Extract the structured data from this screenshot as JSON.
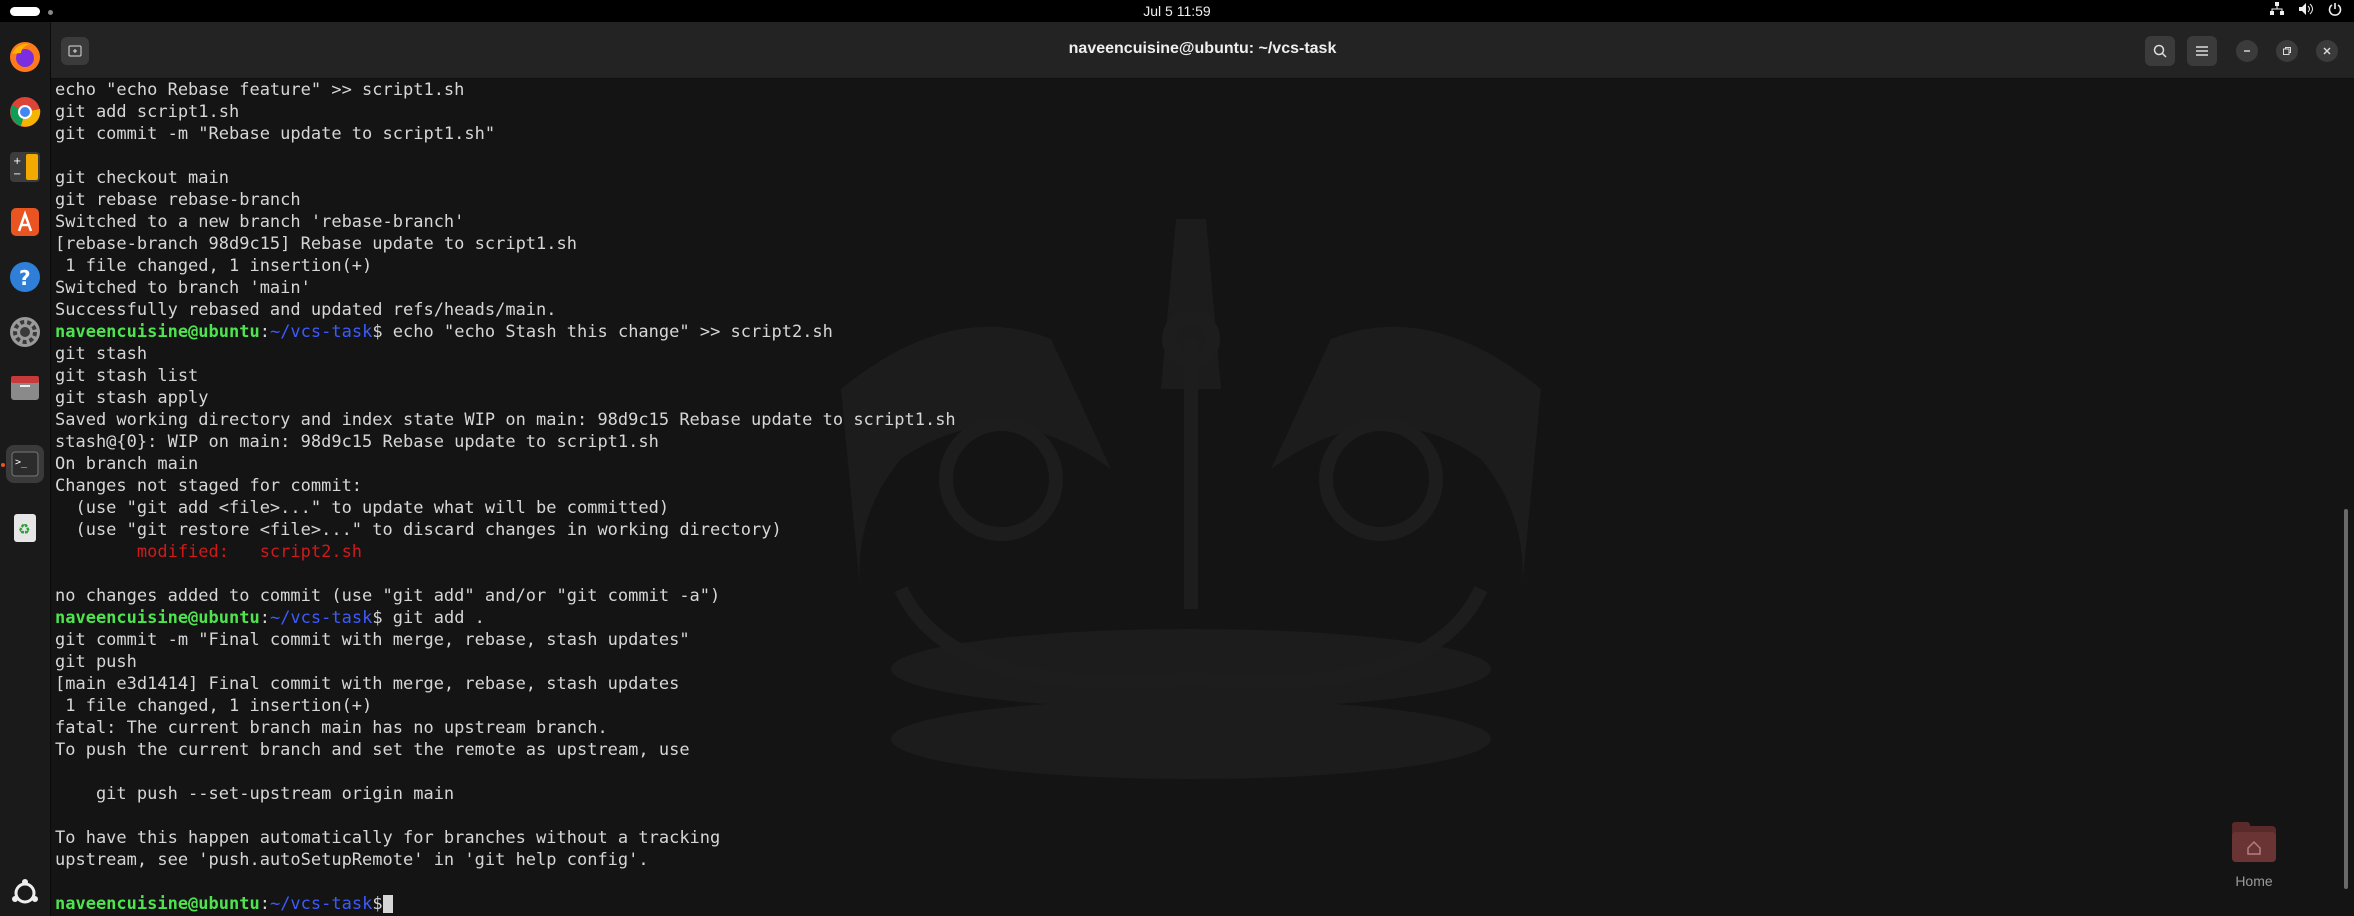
{
  "topbar": {
    "datetime": "Jul 5  11:59",
    "tray_icons": [
      "network-icon",
      "volume-icon",
      "power-icon"
    ]
  },
  "dock": {
    "apps": [
      "firefox-icon",
      "chrome-icon",
      "calculator-icon",
      "app-center-icon",
      "help-icon",
      "settings-icon",
      "files-icon",
      "terminal-icon",
      "trash-icon"
    ],
    "active": "terminal-icon"
  },
  "window": {
    "title": "naveencuisine@ubuntu: ~/vcs-task"
  },
  "prompt": {
    "user": "naveencuisine@ubuntu",
    "sep": ":",
    "path": "~/vcs-task",
    "sign": "$"
  },
  "terminal": {
    "lines": [
      {
        "text": "echo \"echo Rebase feature\" >> script1.sh"
      },
      {
        "text": "git add script1.sh"
      },
      {
        "text": "git commit -m \"Rebase update to script1.sh\""
      },
      {
        "text": ""
      },
      {
        "text": "git checkout main"
      },
      {
        "text": "git rebase rebase-branch"
      },
      {
        "text": "Switched to a new branch 'rebase-branch'"
      },
      {
        "text": "[rebase-branch 98d9c15] Rebase update to script1.sh"
      },
      {
        "text": " 1 file changed, 1 insertion(+)"
      },
      {
        "text": "Switched to branch 'main'"
      },
      {
        "text": "Successfully rebased and updated refs/heads/main."
      },
      {
        "type": "prompt",
        "text": " echo \"echo Stash this change\" >> script2.sh"
      },
      {
        "text": "git stash"
      },
      {
        "text": "git stash list"
      },
      {
        "text": "git stash apply"
      },
      {
        "text": "Saved working directory and index state WIP on main: 98d9c15 Rebase update to script1.sh"
      },
      {
        "text": "stash@{0}: WIP on main: 98d9c15 Rebase update to script1.sh"
      },
      {
        "text": "On branch main"
      },
      {
        "text": "Changes not staged for commit:"
      },
      {
        "text": "  (use \"git add <file>...\" to update what will be committed)"
      },
      {
        "text": "  (use \"git restore <file>...\" to discard changes in working directory)"
      },
      {
        "type": "modified",
        "text": "        modified:   script2.sh"
      },
      {
        "text": ""
      },
      {
        "text": "no changes added to commit (use \"git add\" and/or \"git commit -a\")"
      },
      {
        "type": "prompt",
        "text": " git add ."
      },
      {
        "text": "git commit -m \"Final commit with merge, rebase, stash updates\""
      },
      {
        "text": "git push"
      },
      {
        "text": "[main e3d1414] Final commit with merge, rebase, stash updates"
      },
      {
        "text": " 1 file changed, 1 insertion(+)"
      },
      {
        "text": "fatal: The current branch main has no upstream branch."
      },
      {
        "text": "To push the current branch and set the remote as upstream, use"
      },
      {
        "text": ""
      },
      {
        "text": "    git push --set-upstream origin main"
      },
      {
        "text": ""
      },
      {
        "text": "To have this happen automatically for branches without a tracking"
      },
      {
        "text": "upstream, see 'push.autoSetupRemote' in 'git help config'."
      },
      {
        "text": ""
      },
      {
        "type": "prompt",
        "text": "",
        "cursor": true
      }
    ]
  },
  "desktop": {
    "home_label": "Home"
  }
}
